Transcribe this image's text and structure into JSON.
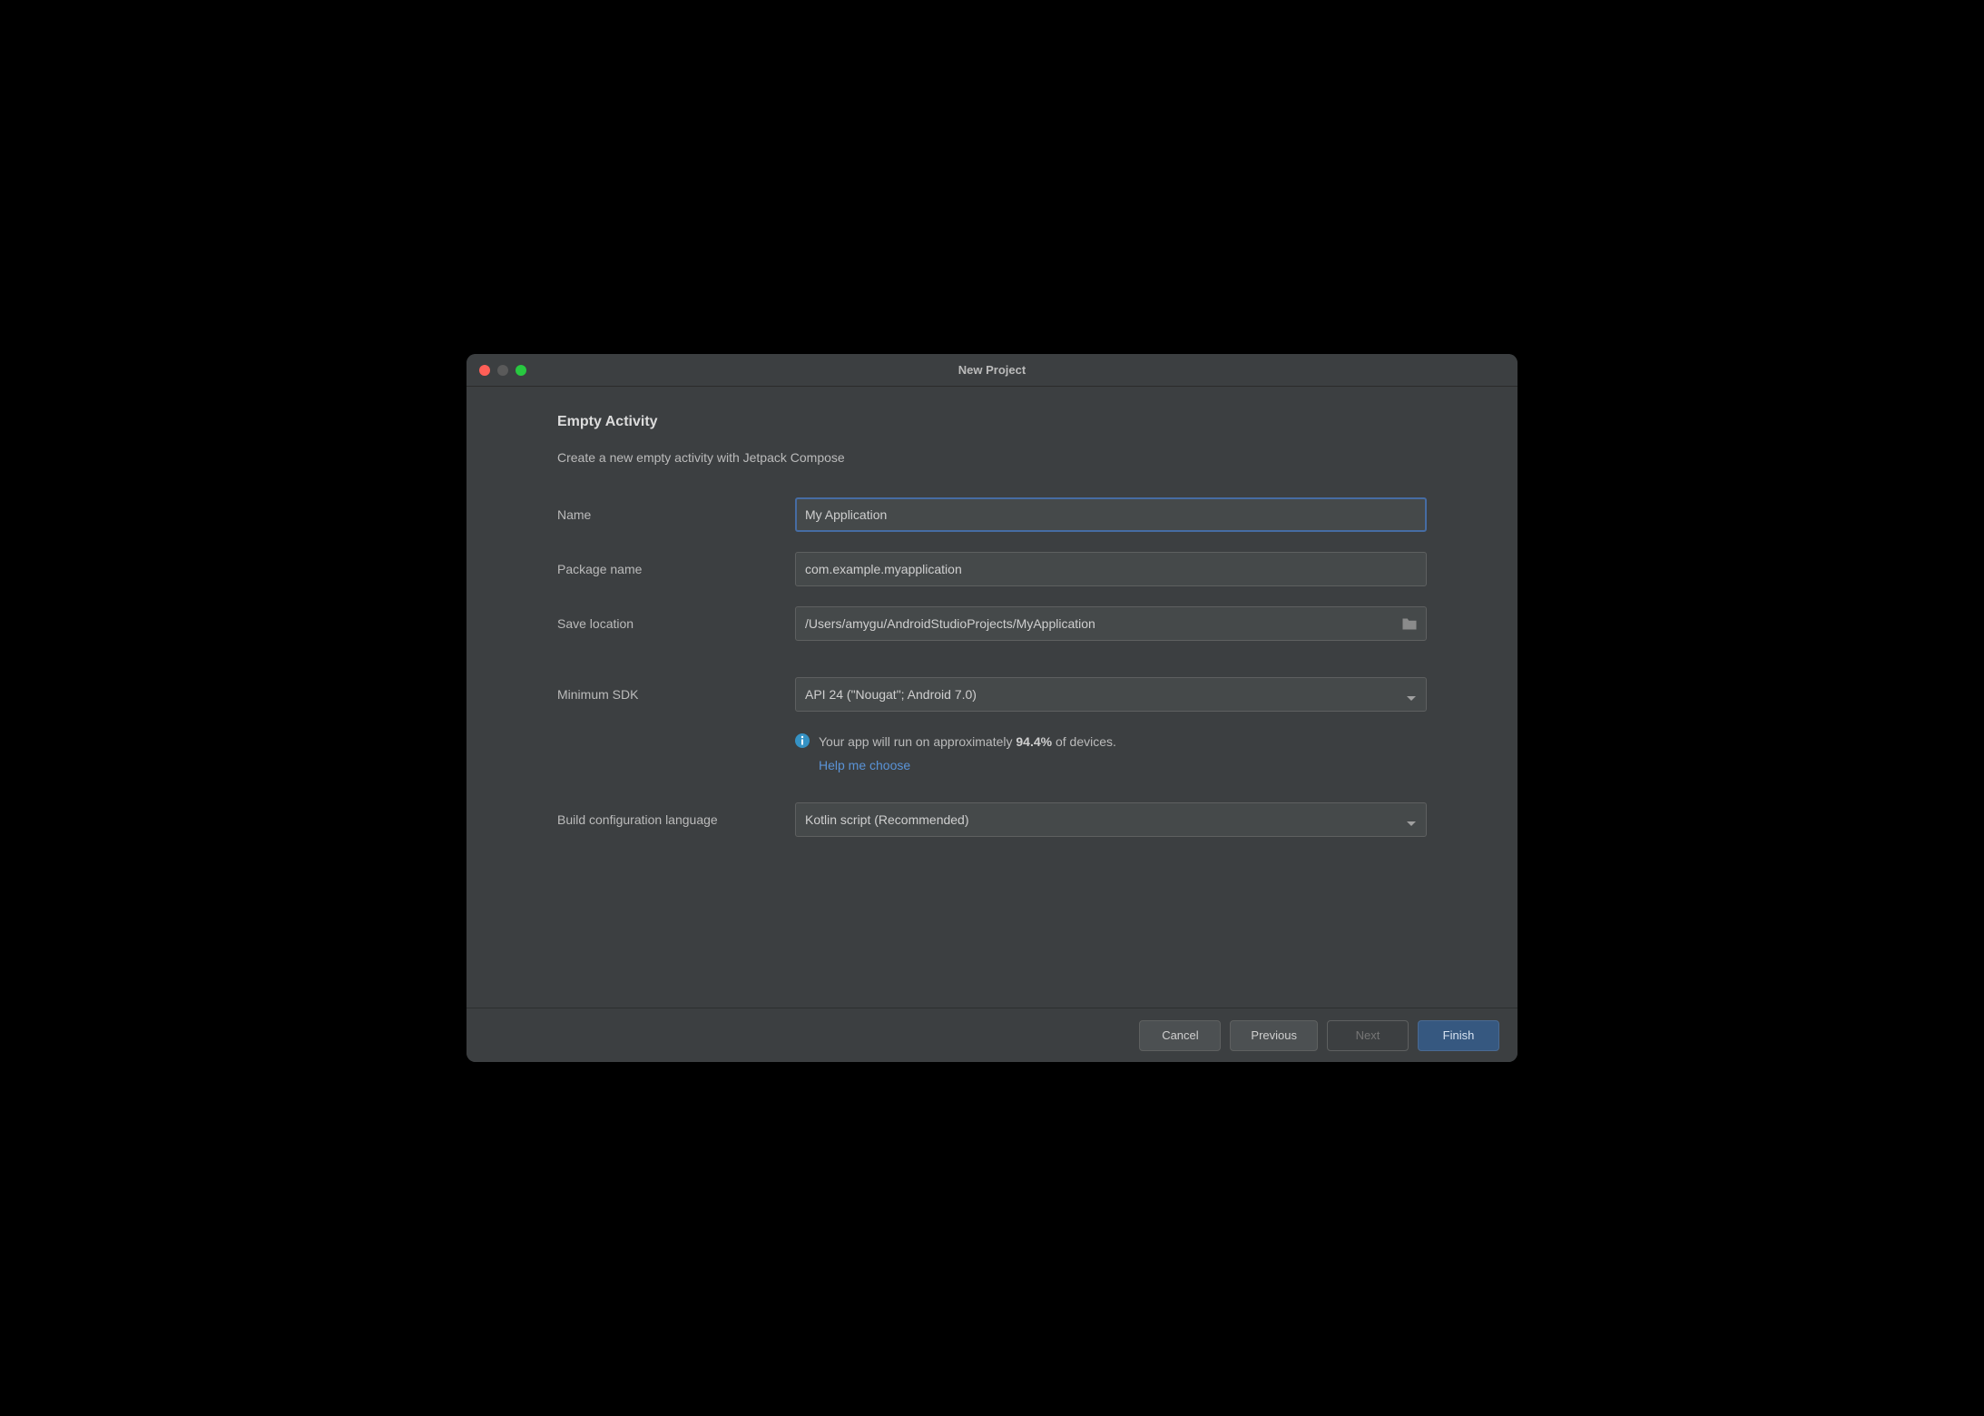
{
  "window": {
    "title": "New Project"
  },
  "page": {
    "heading": "Empty Activity",
    "description": "Create a new empty activity with Jetpack Compose"
  },
  "form": {
    "name_label": "Name",
    "name_value": "My Application",
    "package_label": "Package name",
    "package_value": "com.example.myapplication",
    "location_label": "Save location",
    "location_value": "/Users/amygu/AndroidStudioProjects/MyApplication",
    "sdk_label": "Minimum SDK",
    "sdk_value": "API 24 (\"Nougat\"; Android 7.0)",
    "buildlang_label": "Build configuration language",
    "buildlang_value": "Kotlin script (Recommended)"
  },
  "info": {
    "prefix": "Your app will run on approximately ",
    "percent": "94.4%",
    "suffix": " of devices.",
    "help_link": "Help me choose"
  },
  "footer": {
    "cancel": "Cancel",
    "previous": "Previous",
    "next": "Next",
    "finish": "Finish"
  }
}
